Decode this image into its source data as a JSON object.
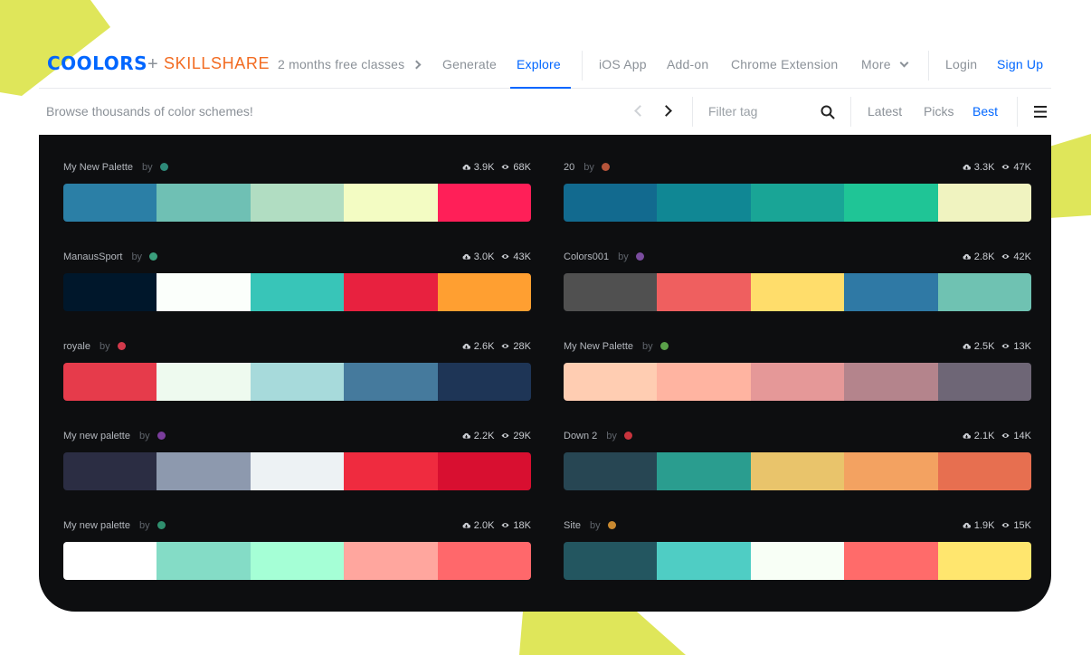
{
  "nav": {
    "logo_text": "COOLORS",
    "plus": "+",
    "partner": "SKILLSHARE",
    "promo": "2 months free classes",
    "generate": "Generate",
    "explore": "Explore",
    "ios_app": "iOS App",
    "addon": "Add-on",
    "chrome_extension": "Chrome Extension",
    "more": "More",
    "login": "Login",
    "signup": "Sign Up"
  },
  "subbar": {
    "browse_text": "Browse thousands of color schemes!",
    "filter_placeholder": "Filter tag",
    "sort_latest": "Latest",
    "sort_picks": "Picks",
    "sort_best": "Best"
  },
  "colors": {
    "accent": "#0066ff",
    "skillshare": "#f26b21",
    "panel_bg": "#0d0e10",
    "decor_yellow": "#dfe65a"
  },
  "palettes": [
    {
      "name": "My New Palette",
      "by": "by",
      "avatar_color": "#2e8a79",
      "saves": "3.9K",
      "views": "68K",
      "colors": [
        "#2b7fa6",
        "#6fc0b4",
        "#b1ddc2",
        "#f3fcc3",
        "#ff1f58"
      ]
    },
    {
      "name": "20",
      "by": "by",
      "avatar_color": "#b5543a",
      "saves": "3.3K",
      "views": "47K",
      "colors": [
        "#126a8f",
        "#108794",
        "#19a596",
        "#1fc596",
        "#f0f3c0"
      ]
    },
    {
      "name": "ManausSport",
      "by": "by",
      "avatar_color": "#3a9e7c",
      "saves": "3.0K",
      "views": "43K",
      "colors": [
        "#00172b",
        "#fbfffb",
        "#38c5b8",
        "#e8213f",
        "#ff9f31"
      ]
    },
    {
      "name": "Colors001",
      "by": "by",
      "avatar_color": "#7a4c9e",
      "saves": "2.8K",
      "views": "42K",
      "colors": [
        "#505050",
        "#ef5f5f",
        "#ffdd6b",
        "#2f79a5",
        "#6fc2b2"
      ]
    },
    {
      "name": "royale",
      "by": "by",
      "avatar_color": "#d2394b",
      "saves": "2.6K",
      "views": "28K",
      "colors": [
        "#e63b4b",
        "#eefaef",
        "#a7dadb",
        "#457a9d",
        "#1e3556"
      ]
    },
    {
      "name": "My New Palette",
      "by": "by",
      "avatar_color": "#5aa04a",
      "saves": "2.5K",
      "views": "13K",
      "colors": [
        "#ffcdb2",
        "#ffb4a1",
        "#e59898",
        "#b4848c",
        "#6e6676"
      ]
    },
    {
      "name": "My new palette",
      "by": "by",
      "avatar_color": "#7a3d9c",
      "saves": "2.2K",
      "views": "29K",
      "colors": [
        "#2b2d43",
        "#8d99ae",
        "#edf2f4",
        "#ef2b3f",
        "#d80f30"
      ]
    },
    {
      "name": "Down 2",
      "by": "by",
      "avatar_color": "#c8343d",
      "saves": "2.1K",
      "views": "14K",
      "colors": [
        "#274653",
        "#2a9d8f",
        "#e9c46b",
        "#f3a261",
        "#e76f50"
      ]
    },
    {
      "name": "My new palette",
      "by": "by",
      "avatar_color": "#2f8f6e",
      "saves": "2.0K",
      "views": "18K",
      "colors": [
        "#ffffff",
        "#84dcc6",
        "#a5ffd6",
        "#ffa69e",
        "#ff686b"
      ]
    },
    {
      "name": "Site",
      "by": "by",
      "avatar_color": "#c98930",
      "saves": "1.9K",
      "views": "15K",
      "colors": [
        "#235660",
        "#4fcdc4",
        "#f8fff6",
        "#ff6b6a",
        "#ffe66e"
      ]
    }
  ]
}
